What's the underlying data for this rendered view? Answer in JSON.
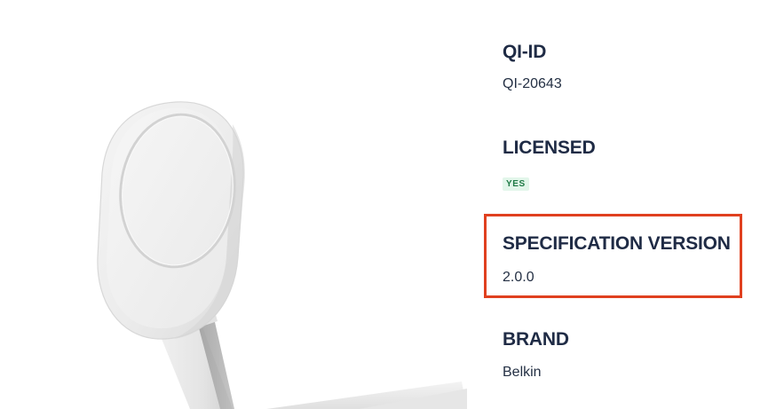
{
  "product": {
    "image_name": "magnetic-wireless-charger-stand"
  },
  "specs": {
    "qi_id": {
      "label": "QI-ID",
      "value": "QI-20643"
    },
    "licensed": {
      "label": "LICENSED",
      "value": "YES"
    },
    "spec_version": {
      "label": "SPECIFICATION VERSION",
      "value": "2.0.0"
    },
    "brand": {
      "label": "BRAND",
      "value": "Belkin"
    }
  },
  "colors": {
    "heading": "#1f2b45",
    "text": "#243044",
    "badge_bg": "#e2f6ea",
    "badge_text": "#1f7a46",
    "highlight": "#e0401f"
  }
}
